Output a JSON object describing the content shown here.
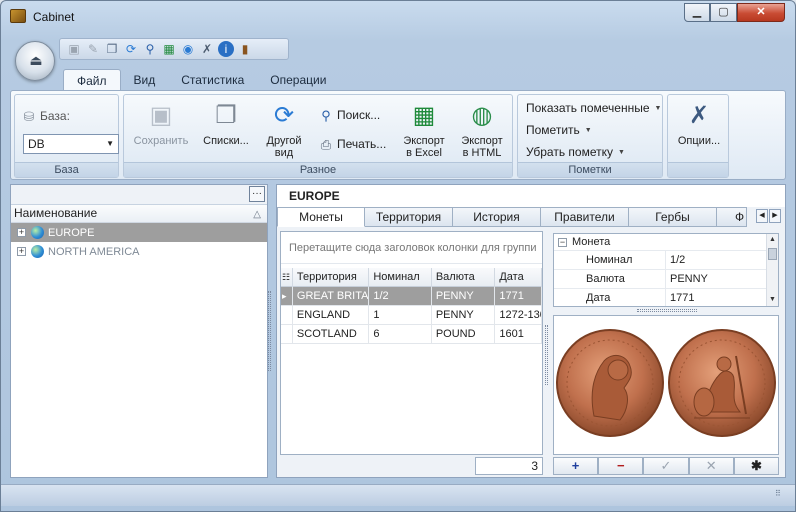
{
  "window": {
    "title": "Cabinet",
    "min_label": "▁",
    "max_label": "▢",
    "close_label": "✕"
  },
  "ribbon": {
    "tabs": [
      {
        "label": "Файл",
        "active": true
      },
      {
        "label": "Вид"
      },
      {
        "label": "Статистика"
      },
      {
        "label": "Операции"
      }
    ],
    "groups": {
      "base": {
        "label": "База",
        "field_label": "База:",
        "combo_value": "DB"
      },
      "misc": {
        "label": "Разное",
        "save": "Сохранить",
        "lists": "Списки...",
        "other_view_line1": "Другой",
        "other_view_line2": "вид",
        "search": "Поиск...",
        "print": "Печать...",
        "export_excel_line1": "Экспорт",
        "export_excel_line2": "в Excel",
        "export_html_line1": "Экспорт",
        "export_html_line2": "в HTML"
      },
      "marks": {
        "label": "Пометки",
        "show_marked": "Показать помеченные",
        "mark": "Пометить",
        "unmark": "Убрать пометку"
      },
      "options": {
        "label": "Опции..."
      }
    }
  },
  "tree": {
    "header": "Наименование",
    "dots_label": "···",
    "items": [
      {
        "label": "EUROPE",
        "expander": "+",
        "selected": true
      },
      {
        "label": "NORTH AMERICA",
        "expander": "+"
      }
    ]
  },
  "detail": {
    "title": "EUROPE",
    "tabs": [
      {
        "label": "Монеты",
        "active": true
      },
      {
        "label": "Территория"
      },
      {
        "label": "История"
      },
      {
        "label": "Правители"
      },
      {
        "label": "Гербы"
      },
      {
        "label": "Ф"
      }
    ],
    "group_hint": "Перетащите сюда заголовок колонки для группи",
    "columns": [
      "Территория",
      "Номинал",
      "Валюта",
      "Дата"
    ],
    "rows": [
      {
        "indicator": "▸",
        "territory": "GREAT BRITA",
        "nominal": "1/2",
        "currency": "PENNY",
        "date": "1771",
        "selected": true
      },
      {
        "indicator": "",
        "territory": "ENGLAND",
        "nominal": "1",
        "currency": "PENNY",
        "date": "1272-130",
        "selected": false
      },
      {
        "indicator": "",
        "territory": "SCOTLAND",
        "nominal": "6",
        "currency": "POUND",
        "date": "1601",
        "selected": false
      }
    ],
    "record_count": "3",
    "properties": {
      "category": "Монета",
      "items": [
        {
          "key": "Номинал",
          "value": "1/2"
        },
        {
          "key": "Валюта",
          "value": "PENNY"
        },
        {
          "key": "Дата",
          "value": "1771"
        }
      ]
    },
    "nav": {
      "add": "+",
      "remove": "−",
      "confirm": "✓",
      "cancel": "✕",
      "all": "✱"
    }
  },
  "colors": {
    "selection": "#9e9e9e",
    "coin_copper": "#c0704d"
  }
}
